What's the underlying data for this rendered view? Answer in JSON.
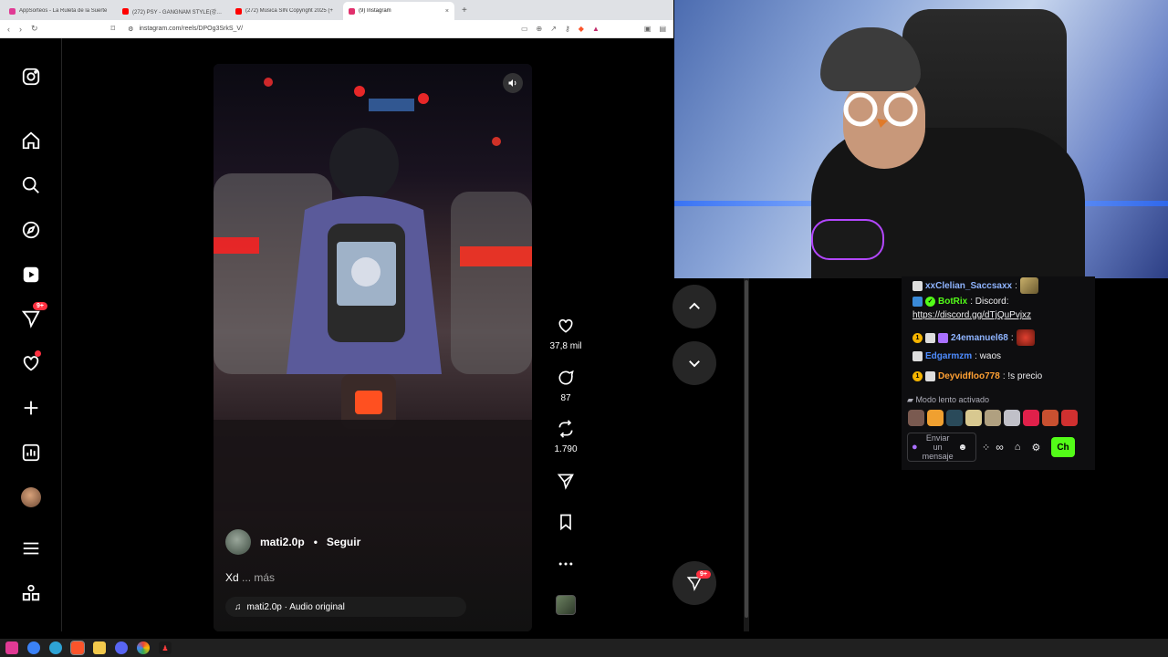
{
  "browser": {
    "tabs": [
      {
        "title": "AppSorteos - La Ruleta de la Suerte",
        "color": "#e03a94"
      },
      {
        "title": "(272) PSY - GANGNAM STYLE(강남스",
        "color": "#ff0000"
      },
      {
        "title": "(272) Música SIN Copyright 2025 (+",
        "color": "#ff0000"
      },
      {
        "title": "(9) Instagram",
        "color": "#e1306c",
        "active": true
      }
    ],
    "new_tab": "+",
    "close": "×",
    "url": "instagram.com/reels/DPOg3SrkS_V/"
  },
  "instagram": {
    "sidebar_badges": {
      "messages": "9+"
    },
    "reel": {
      "username": "mati2.0p",
      "separator": "•",
      "follow_label": "Seguir",
      "caption": "Xd",
      "caption_more": "... más",
      "audio": "mati2.0p · Audio original"
    },
    "actions": {
      "likes": "37,8 mil",
      "comments": "87",
      "reposts": "1.790"
    },
    "floating_badge": "9+"
  },
  "chat": {
    "messages": [
      {
        "user": "xxClelian_Saccsaxx",
        "text": "",
        "color": "#8fb4ff"
      },
      {
        "user": "BotRix",
        "text": ": Discord:",
        "color": "#53fc18"
      },
      {
        "user": "",
        "text": "https://discord.gg/dTjQuPvjxz",
        "color": "#efeff1"
      },
      {
        "user": "24emanuel68",
        "text": ":",
        "color": "#8fb4ff"
      },
      {
        "user": "Edgarmzm",
        "text": ": waos",
        "color": "#4e8cff"
      },
      {
        "user": "Deyvidfloo778",
        "text": ": !s precio",
        "color": "#ffa033"
      }
    ],
    "slow_mode": "Modo lento activado",
    "input_placeholder": "Enviar un mensaje",
    "chat_button": "Ch"
  },
  "colors": {
    "accent": "#53fc18",
    "ig_badge": "#ff3040"
  }
}
